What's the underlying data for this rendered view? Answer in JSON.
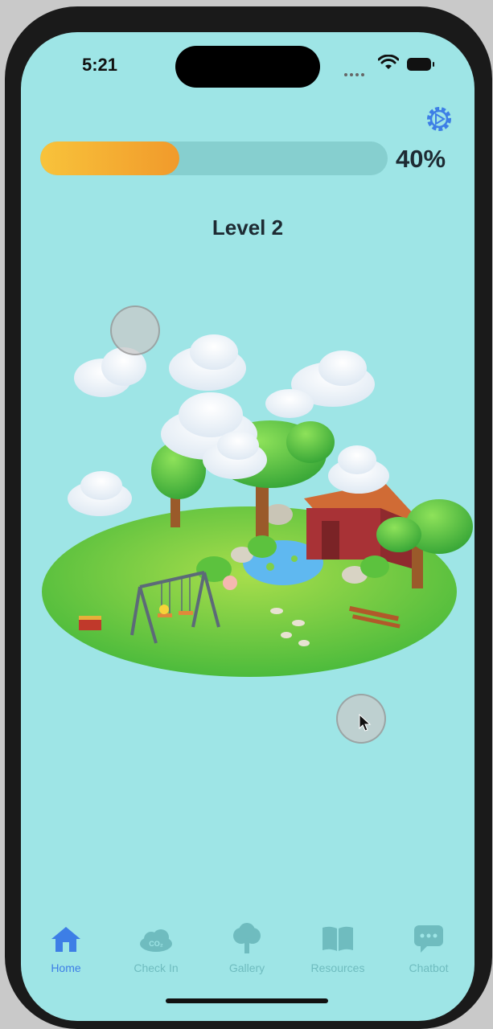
{
  "status_bar": {
    "time": "5:21"
  },
  "progress": {
    "value": 0.4,
    "label": "40%"
  },
  "level": {
    "label": "Level 2"
  },
  "tabs": [
    {
      "label": "Home",
      "icon": "house-icon",
      "active": true
    },
    {
      "label": "Check In",
      "icon": "co2-cloud-icon",
      "active": false
    },
    {
      "label": "Gallery",
      "icon": "tree-icon",
      "active": false
    },
    {
      "label": "Resources",
      "icon": "book-icon",
      "active": false
    },
    {
      "label": "Chatbot",
      "icon": "chat-bubble-icon",
      "active": false
    }
  ],
  "colors": {
    "background": "#9ee5e6",
    "accent": "#3d7ee6",
    "progress_fill": "#f4a833",
    "inactive_tab": "#6fbcbf"
  }
}
